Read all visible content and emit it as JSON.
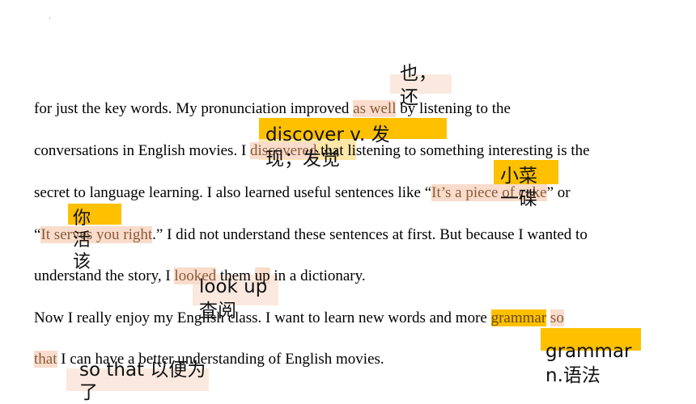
{
  "paragraph": {
    "line1": {
      "before": "for just the key words. My pronunciation improved ",
      "hl": "as well",
      "after": " by listening to the"
    },
    "line2": {
      "before": "conversations in English movies. I ",
      "hl": "discovered",
      "after": " that listening to something interesting is the"
    },
    "line3": {
      "before": "secret to language learning. I also learned useful sentences like “",
      "hl": "It’s a piece of cake",
      "after": "” or"
    },
    "line4": {
      "before": "“",
      "hl": "It serves you right",
      "after": ".” I did not understand these sentences at first. But because I wanted to"
    },
    "line5": {
      "before": "understand the story, I ",
      "hl1": "looked",
      "mid": " them ",
      "hl2": "up",
      "after": " in a dictionary."
    },
    "line6": {
      "before": "Now I really enjoy my English class. I want to learn new words and more ",
      "hl1": "grammar",
      "mid": " ",
      "hl2": "so"
    },
    "line7": {
      "hl": "that",
      "after": " I can have a better understanding of English movies."
    }
  },
  "notes": {
    "also": "也，还",
    "discover": "discover v. 发现；发觉",
    "cake": "小菜一碟",
    "serves": "你活该",
    "look_up": "look up 查阅",
    "grammar": "grammar n.语法",
    "so_that": "so that 以便为了"
  },
  "marker": "·"
}
